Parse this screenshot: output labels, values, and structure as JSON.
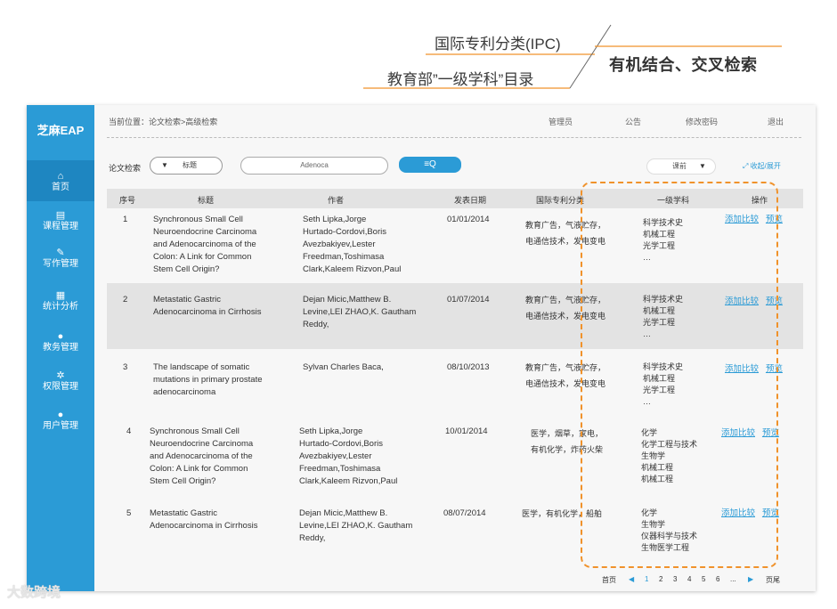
{
  "annotation": {
    "ipc": "国际专利分类(IPC)",
    "edu": "教育部”一级学科”目录",
    "right": "有机结合、交叉检索"
  },
  "sidebar": {
    "logo": "芝麻EAP",
    "items": [
      {
        "icon": "home-icon",
        "glyph": "⌂",
        "label": "首页"
      },
      {
        "icon": "course-icon",
        "glyph": "▤",
        "label": "课程管理"
      },
      {
        "icon": "write-icon",
        "glyph": "✎",
        "label": "写作管理"
      },
      {
        "icon": "stats-icon",
        "glyph": "▦",
        "label": "统计分析"
      },
      {
        "icon": "user-icon",
        "glyph": "●",
        "label": "教务管理"
      },
      {
        "icon": "gear-icon",
        "glyph": "✲",
        "label": "权限管理"
      },
      {
        "icon": "users-icon",
        "glyph": "●",
        "label": "用户管理"
      }
    ]
  },
  "topbar": {
    "breadcrumb": "当前位置：论文检索>高级检索",
    "links": [
      "管理员",
      "公告",
      "修改密码",
      "退出"
    ]
  },
  "search": {
    "label": "论文检索",
    "field": "标题",
    "query": "Adenoca",
    "button_glyph": "≡Q",
    "course": "课前",
    "collapse": "⤢ 收起/展开"
  },
  "table": {
    "headers": [
      "序号",
      "标题",
      "作者",
      "发表日期",
      "国际专利分类",
      "一级学科",
      "操作"
    ],
    "rows": [
      {
        "no": "1",
        "title": [
          "Synchronous Small Cell",
          "Neuroendocrine Carcinoma",
          "and Adenocarcinoma of the",
          "Colon: A Link for Common",
          "Stem Cell Origin?"
        ],
        "author": [
          "Seth Lipka,Jorge",
          "Hurtado-Cordovi,Boris",
          "Avezbakiyev,Lester",
          "Freedman,Toshimasa",
          "Clark,Kaleem Rizvon,Paul"
        ],
        "date": "01/01/2014",
        "ipc": [
          "教育广告，气液贮存，",
          "电通信技术，发电变电"
        ],
        "subject": [
          "科学技术史",
          "机械工程",
          "光学工程",
          "…"
        ],
        "add": "添加比较",
        "preview": "预览"
      },
      {
        "no": "2",
        "title": [
          "Metastatic Gastric",
          "Adenocarcinoma in Cirrhosis"
        ],
        "author": [
          "Dejan Micic,Matthew B.",
          "Levine,LEI ZHAO,K. Gautham",
          "Reddy,"
        ],
        "date": "01/07/2014",
        "ipc": [
          "教育广告，气液贮存，",
          "电通信技术，发电变电"
        ],
        "subject": [
          "科学技术史",
          "机械工程",
          "光学工程",
          "…"
        ],
        "add": "添加比较",
        "preview": "预览"
      },
      {
        "no": "3",
        "title": [
          "The landscape of somatic",
          "mutations in primary prostate",
          "adenocarcinoma"
        ],
        "author": [
          "Sylvan Charles Baca,"
        ],
        "date": "08/10/2013",
        "ipc": [
          "教育广告，气液贮存，",
          "电通信技术，发电变电"
        ],
        "subject": [
          "科学技术史",
          "机械工程",
          "光学工程",
          "…"
        ],
        "add": "添加比较",
        "preview": "预览"
      },
      {
        "no": "4",
        "title": [
          "Synchronous Small Cell",
          "Neuroendocrine Carcinoma",
          "and Adenocarcinoma of the",
          "Colon: A Link for Common",
          "Stem Cell Origin?"
        ],
        "author": [
          "Seth Lipka,Jorge",
          "Hurtado-Cordovi,Boris",
          "Avezbakiyev,Lester",
          "Freedman,Toshimasa",
          "Clark,Kaleem Rizvon,Paul"
        ],
        "date": "10/01/2014",
        "ipc": [
          "医学，烟草，家电，",
          "有机化学，炸药火柴"
        ],
        "subject": [
          "化学",
          "化学工程与技术",
          "生物学",
          "机械工程",
          "机械工程"
        ],
        "add": "添加比较",
        "preview": "预览"
      },
      {
        "no": "5",
        "title": [
          "Metastatic Gastric",
          "Adenocarcinoma in Cirrhosis"
        ],
        "author": [
          "Dejan Micic,Matthew B.",
          "Levine,LEI ZHAO,K. Gautham",
          "Reddy,"
        ],
        "date": "08/07/2014",
        "ipc": [
          "医学，有机化学，船舶"
        ],
        "subject": [
          "化学",
          "生物学",
          "仪器科学与技术",
          "生物医学工程"
        ],
        "add": "添加比较",
        "preview": "预览"
      }
    ]
  },
  "pager": {
    "first": "首页",
    "prev": "◀",
    "pages": [
      "1",
      "2",
      "3",
      "4",
      "5",
      "6",
      "..."
    ],
    "next": "▶",
    "last": "页尾"
  },
  "watermark": "大数跨境",
  "colors": {
    "accent": "#2b9bd6",
    "highlight": "#f0922b",
    "row_shade": "#e3e3e3"
  }
}
